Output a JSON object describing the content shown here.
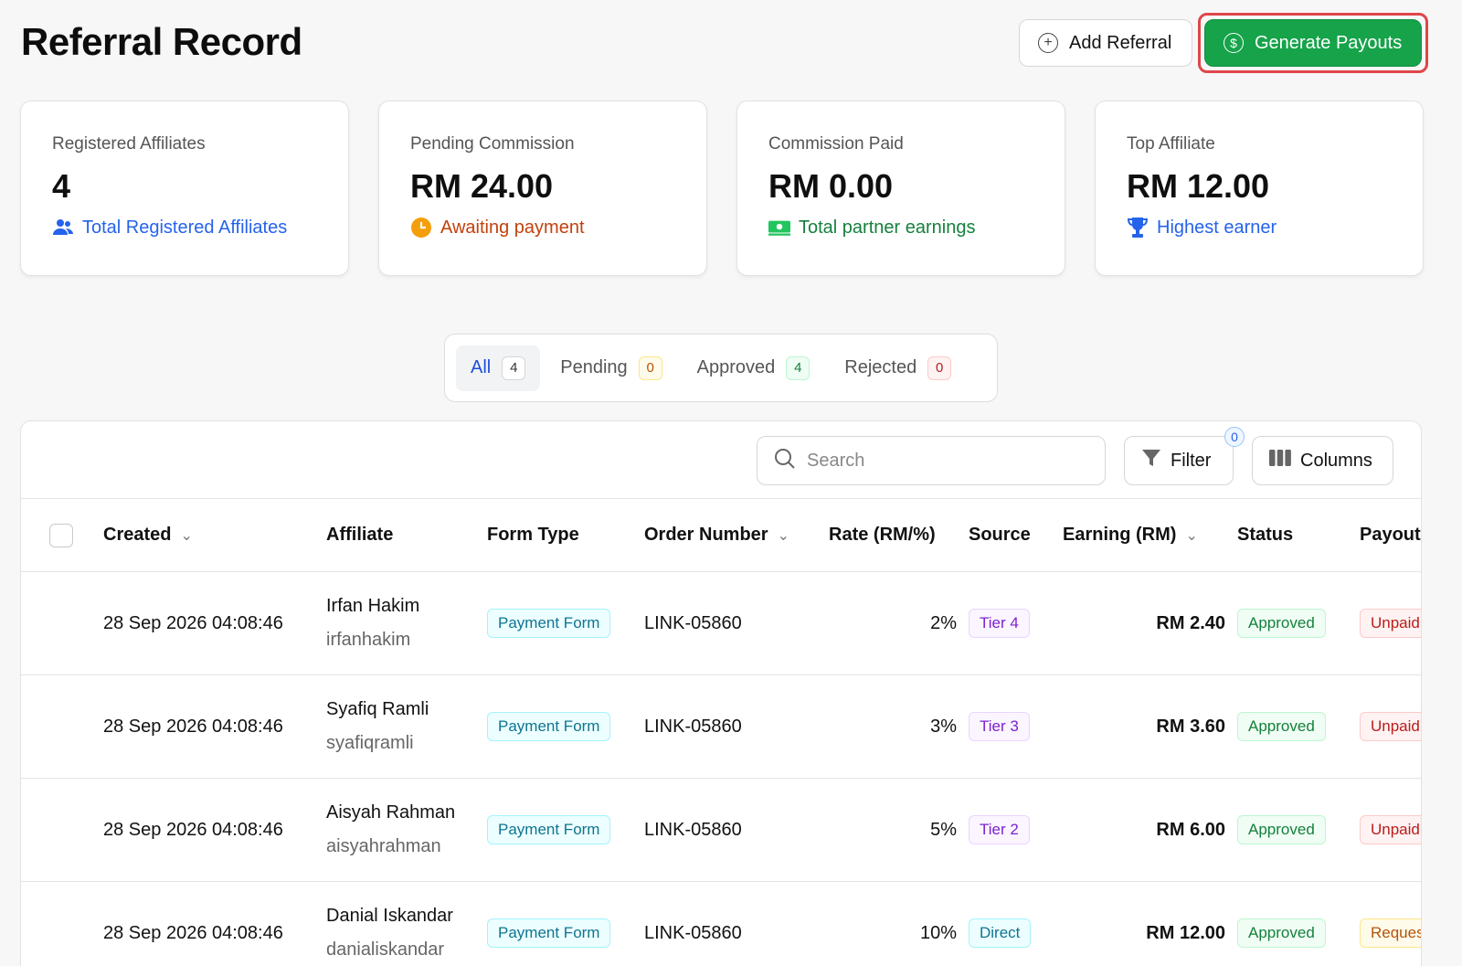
{
  "header": {
    "title": "Referral Record",
    "add_referral_label": "Add Referral",
    "generate_payouts_label": "Generate Payouts"
  },
  "colors": {
    "accent_green": "#16a34a",
    "highlight_border": "#e0464a",
    "link_blue": "#2563eb"
  },
  "stats": [
    {
      "label": "Registered Affiliates",
      "value": "4",
      "sub": "Total Registered Affiliates",
      "icon": "users-icon"
    },
    {
      "label": "Pending Commission",
      "value": "RM 24.00",
      "sub": "Awaiting payment",
      "icon": "clock-icon"
    },
    {
      "label": "Commission Paid",
      "value": "RM 0.00",
      "sub": "Total partner earnings",
      "icon": "cash-icon"
    },
    {
      "label": "Top Affiliate",
      "value": "RM 12.00",
      "sub": "Highest earner",
      "icon": "trophy-icon"
    }
  ],
  "tabs": [
    {
      "label": "All",
      "count": "4"
    },
    {
      "label": "Pending",
      "count": "0"
    },
    {
      "label": "Approved",
      "count": "4"
    },
    {
      "label": "Rejected",
      "count": "0"
    }
  ],
  "toolbar": {
    "search_placeholder": "Search",
    "filter_label": "Filter",
    "filter_count": "0",
    "columns_label": "Columns"
  },
  "table": {
    "columns": [
      "Created",
      "Affiliate",
      "Form Type",
      "Order Number",
      "Rate (RM/%)",
      "Source",
      "Earning (RM)",
      "Status",
      "Payout"
    ],
    "rows": [
      {
        "created": "28 Sep 2026 04:08:46",
        "name": "Irfan Hakim",
        "handle": "irfanhakim",
        "form_type": "Payment Form",
        "order": "LINK-05860",
        "rate": "2%",
        "source": "Tier 4",
        "earning": "RM 2.40",
        "status": "Approved",
        "payout": "Unpaid"
      },
      {
        "created": "28 Sep 2026 04:08:46",
        "name": "Syafiq Ramli",
        "handle": "syafiqramli",
        "form_type": "Payment Form",
        "order": "LINK-05860",
        "rate": "3%",
        "source": "Tier 3",
        "earning": "RM 3.60",
        "status": "Approved",
        "payout": "Unpaid"
      },
      {
        "created": "28 Sep 2026 04:08:46",
        "name": "Aisyah Rahman",
        "handle": "aisyahrahman",
        "form_type": "Payment Form",
        "order": "LINK-05860",
        "rate": "5%",
        "source": "Tier 2",
        "earning": "RM 6.00",
        "status": "Approved",
        "payout": "Unpaid"
      },
      {
        "created": "28 Sep 2026 04:08:46",
        "name": "Danial Iskandar",
        "handle": "danialiskandar",
        "form_type": "Payment Form",
        "order": "LINK-05860",
        "rate": "10%",
        "source": "Direct",
        "earning": "RM 12.00",
        "status": "Approved",
        "payout": "Reques"
      }
    ]
  }
}
